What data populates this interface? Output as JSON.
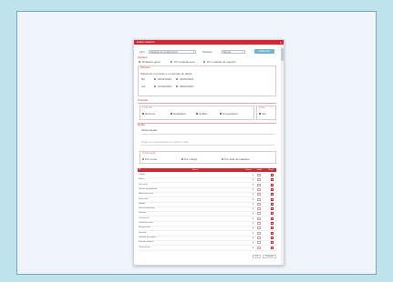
{
  "window": {
    "title": "Editar relatório",
    "close": "×"
  },
  "toolbar": {
    "type_label": "Tipo",
    "type_value": "Relatório de equipamentos",
    "period_label": "Período",
    "period_value": "Mensal",
    "apply_button": "Aplicar filtro"
  },
  "section_options": {
    "heading": "Opções",
    "radios": [
      "Relatório geral",
      "Por equipamento",
      "Por unidade de negócio"
    ],
    "sub_heading": "Período",
    "range_text": "Selecione o período e o intervalo de datas",
    "date_rows": [
      {
        "label": "De",
        "a": "01/01/2024",
        "b": "31/01/2024"
      },
      {
        "label": "Até",
        "a": "01/02/2024",
        "b": "28/02/2024"
      }
    ]
  },
  "section_format": {
    "heading": "Formato",
    "left_title": "Colunas",
    "right_title": "Total",
    "checks": [
      "Resumo",
      "Detalhado",
      "Gráfico",
      "Comparativo"
    ],
    "total_value": "Sim"
  },
  "section_notes": {
    "heading": "Notas",
    "note_label": "Observações",
    "note_hint": "Digite as observações do relatório aqui"
  },
  "section_sort": {
    "heading": "Ordenação",
    "options": [
      "Por nome",
      "Por código",
      "Por data de cadastro"
    ]
  },
  "grid": {
    "headers": [
      "Nº",
      "Nome",
      "Ordem",
      "Exibir",
      "Obrig."
    ],
    "rows": [
      {
        "name": "Código"
      },
      {
        "name": "Nome"
      },
      {
        "name": "Descrição"
      },
      {
        "name": "Tipo de equipamento"
      },
      {
        "name": "Número de série"
      },
      {
        "name": "Fabricante"
      },
      {
        "name": "Modelo"
      },
      {
        "name": "Data de aquisição"
      },
      {
        "name": "Garantia"
      },
      {
        "name": "Localização"
      },
      {
        "name": "Centro de custo"
      },
      {
        "name": "Responsável"
      },
      {
        "name": "Situação"
      },
      {
        "name": "Unidade de negócio"
      },
      {
        "name": "Data de cadastro"
      },
      {
        "name": "Observações"
      }
    ],
    "marker": "▾"
  },
  "footer": {
    "ok": "OK",
    "cancel": "Cancelar"
  }
}
